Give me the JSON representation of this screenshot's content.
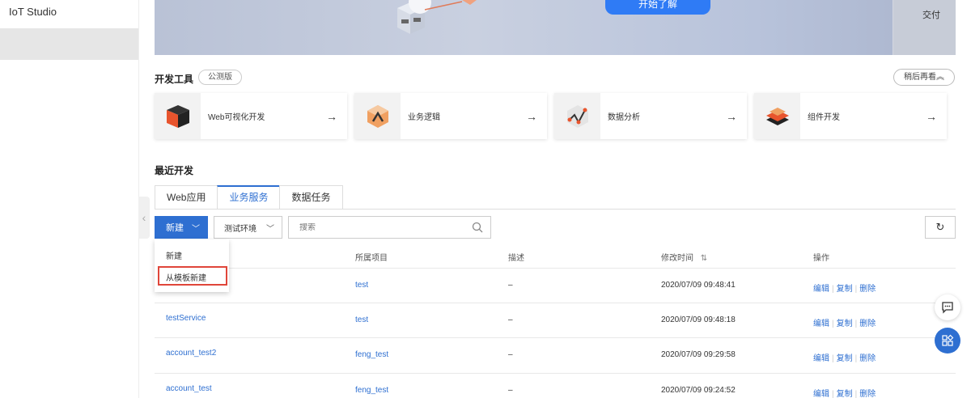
{
  "sidebar": {
    "brand": "IoT Studio"
  },
  "banner": {
    "cta_label": "开始了解",
    "side_label": "交付"
  },
  "dev_tools": {
    "title": "开发工具",
    "badge": "公测版",
    "later_label": "稍后再看",
    "cards": [
      {
        "label": "Web可视化开发",
        "icon": "web-visual-icon"
      },
      {
        "label": "业务逻辑",
        "icon": "business-logic-icon"
      },
      {
        "label": "数据分析",
        "icon": "data-analysis-icon"
      },
      {
        "label": "组件开发",
        "icon": "component-dev-icon"
      }
    ]
  },
  "recent": {
    "title": "最近开发",
    "tabs": [
      "Web应用",
      "业务服务",
      "数据任务"
    ],
    "active_tab": "业务服务"
  },
  "toolbar": {
    "new_label": "新建",
    "env_label": "测试环境",
    "search_placeholder": "搜索"
  },
  "dropdown": {
    "items": [
      "新建",
      "从模板新建"
    ]
  },
  "table": {
    "headers": [
      "所属项目",
      "描述",
      "修改时间",
      "操作"
    ],
    "rows": [
      {
        "name": "",
        "project": "test",
        "desc": "–",
        "time": "2020/07/09 09:48:41"
      },
      {
        "name": "testService",
        "project": "test",
        "desc": "–",
        "time": "2020/07/09 09:48:18"
      },
      {
        "name": "account_test2",
        "project": "feng_test",
        "desc": "–",
        "time": "2020/07/09 09:29:58"
      },
      {
        "name": "account_test",
        "project": "feng_test",
        "desc": "–",
        "time": "2020/07/09 09:24:52"
      }
    ],
    "actions": {
      "edit": "编辑",
      "copy": "复制",
      "delete": "删除"
    }
  }
}
